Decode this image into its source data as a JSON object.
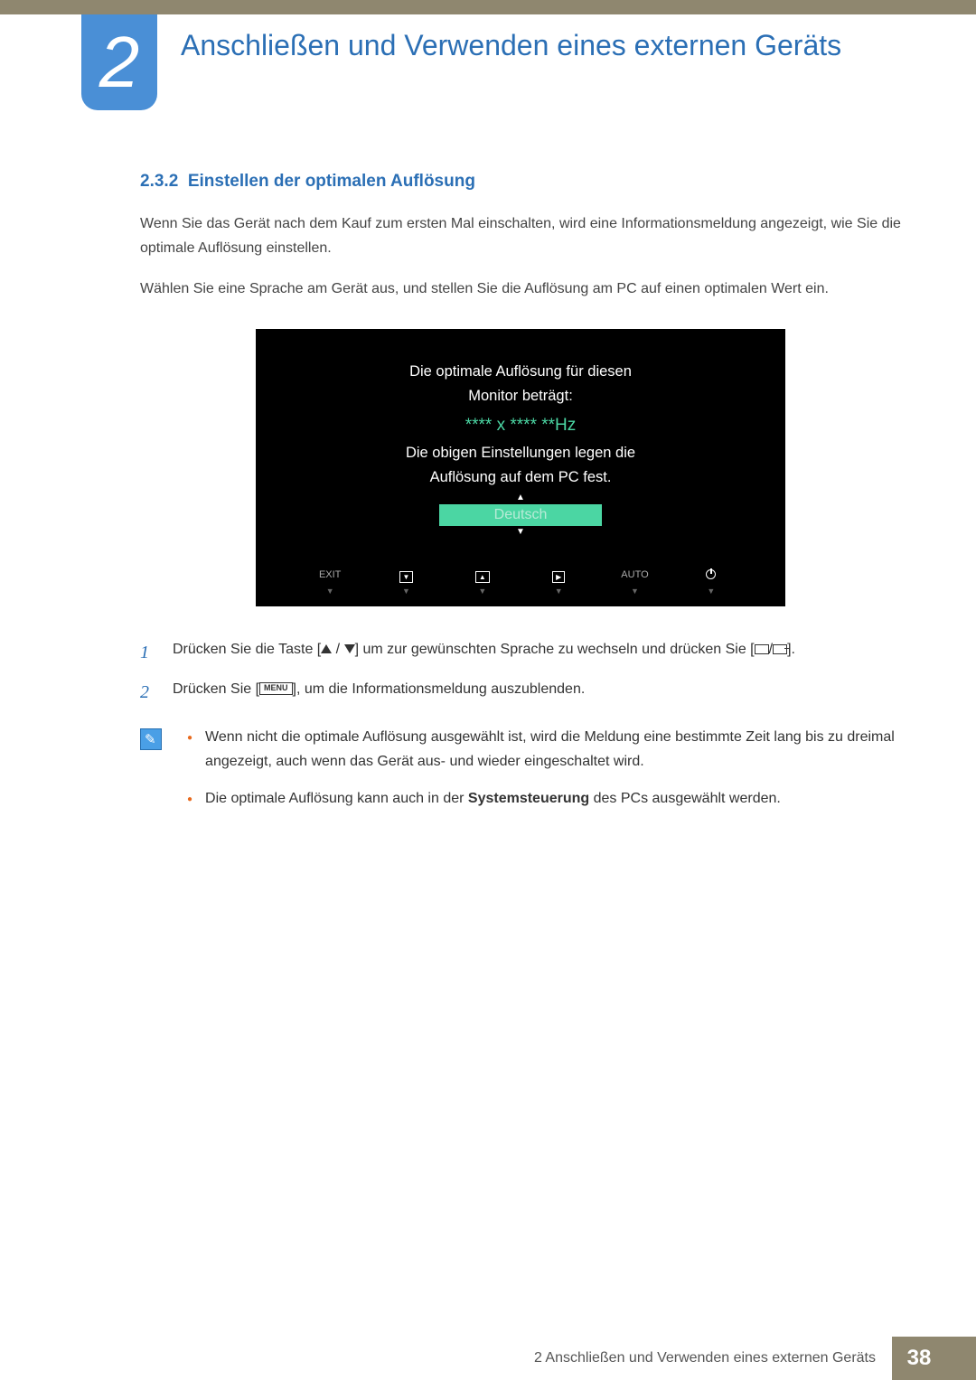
{
  "chapter": {
    "number": "2",
    "title": "Anschließen und Verwenden eines externen Geräts"
  },
  "section": {
    "number": "2.3.2",
    "title": "Einstellen der optimalen Auflösung"
  },
  "paragraphs": {
    "p1": "Wenn Sie das Gerät nach dem Kauf zum ersten Mal einschalten, wird eine Informationsmeldung angezeigt, wie Sie die optimale Auflösung einstellen.",
    "p2": "Wählen Sie eine Sprache am Gerät aus, und stellen Sie die Auflösung am PC auf einen optimalen Wert ein."
  },
  "osd": {
    "line1": "Die optimale Auflösung für diesen",
    "line2": "Monitor beträgt:",
    "resolution": "**** x **** **Hz",
    "line3": "Die obigen Einstellungen legen die",
    "line4": "Auflösung auf dem PC fest.",
    "language": "Deutsch",
    "btn_exit": "EXIT",
    "btn_auto": "AUTO"
  },
  "steps": {
    "s1_num": "1",
    "s1_a": "Drücken Sie die Taste [",
    "s1_b": "] um zur gewünschten Sprache zu wechseln und drücken Sie [",
    "s1_c": "].",
    "s2_num": "2",
    "s2_a": "Drücken Sie [",
    "s2_menu": "MENU",
    "s2_b": "], um die Informationsmeldung auszublenden."
  },
  "notes": {
    "n1": "Wenn nicht die optimale Auflösung ausgewählt ist, wird die Meldung eine bestimmte Zeit lang bis zu dreimal angezeigt, auch wenn das Gerät aus- und wieder eingeschaltet wird.",
    "n2_a": "Die optimale Auflösung kann auch in der ",
    "n2_bold": "Systemsteuerung",
    "n2_b": " des PCs ausgewählt werden."
  },
  "footer": {
    "text": "2 Anschließen und Verwenden eines externen Geräts",
    "page": "38"
  }
}
